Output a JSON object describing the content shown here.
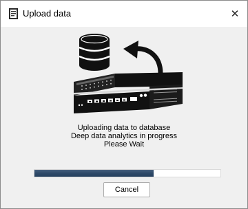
{
  "window": {
    "title": "Upload data",
    "icon": "document-upload-icon",
    "close_glyph": "✕"
  },
  "illustration": {
    "icons": [
      "database-icon",
      "curved-arrow-icon",
      "network-server-icon"
    ]
  },
  "status": {
    "line1": "Uploading data to database",
    "line2": "Deep data analytics in progress",
    "line3": "Please Wait"
  },
  "progress": {
    "fraction": 0.64,
    "fill_color": "#2f4a69"
  },
  "buttons": {
    "cancel_label": "Cancel"
  }
}
